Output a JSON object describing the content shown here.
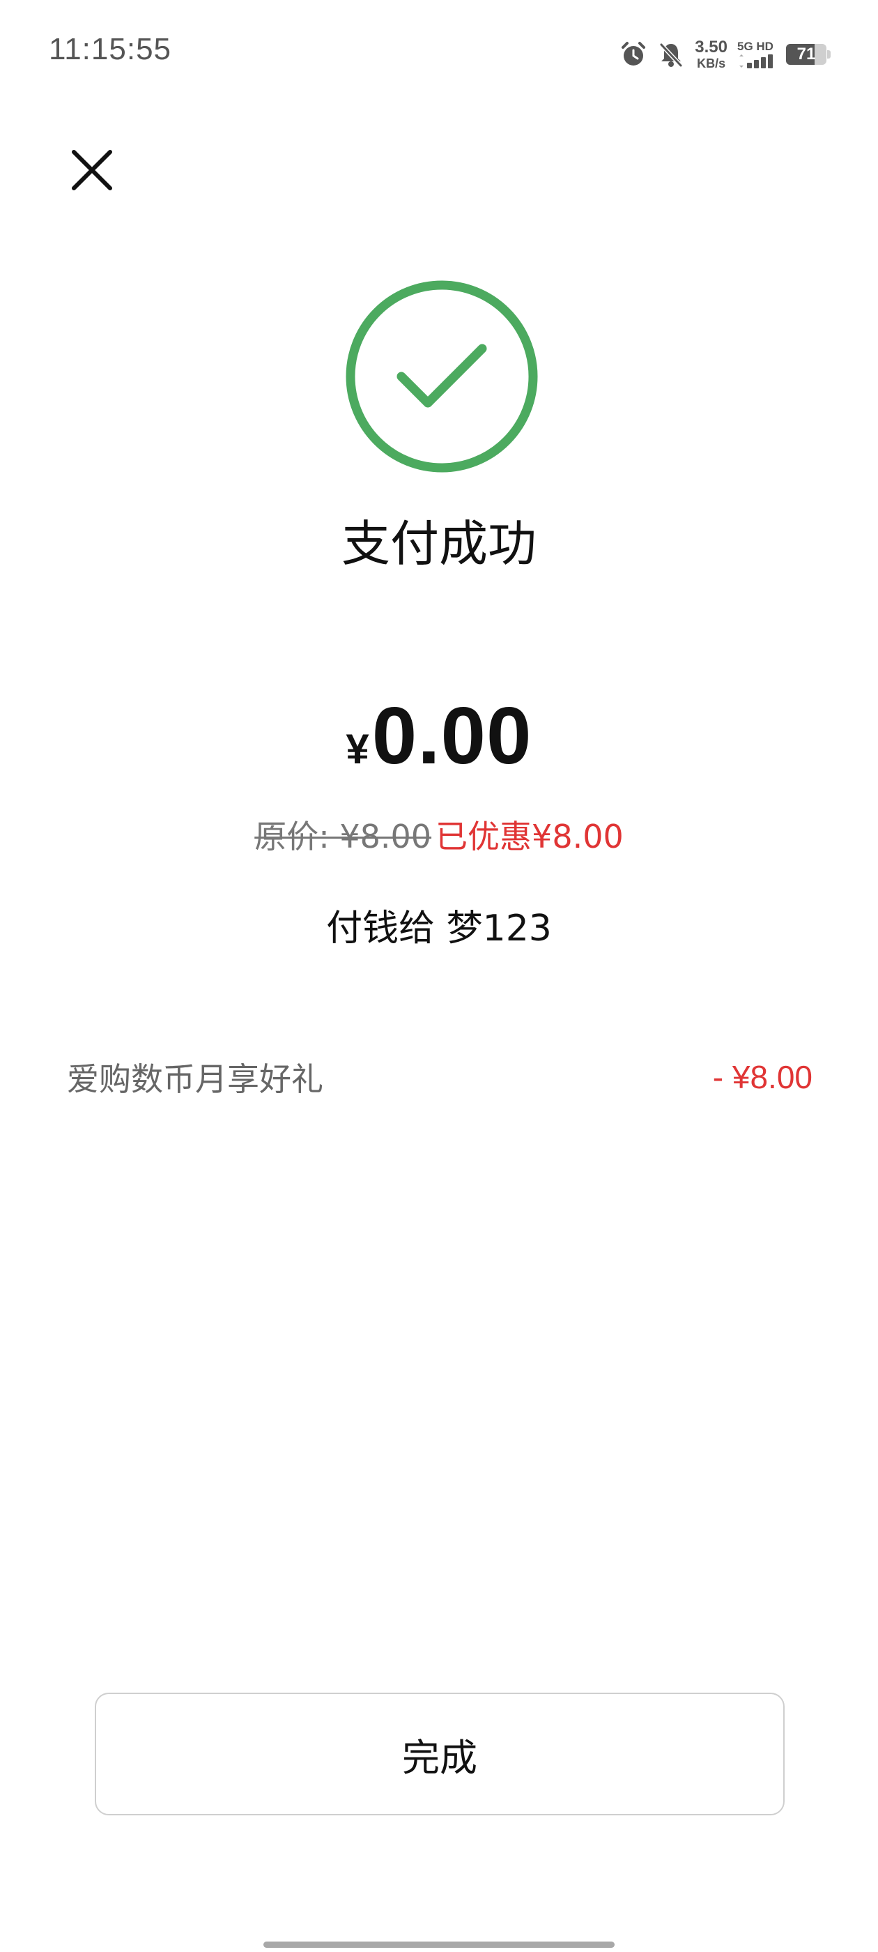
{
  "status_bar": {
    "time": "11:15:55",
    "net_speed_value": "3.50",
    "net_speed_unit": "KB/s",
    "network_label": "5G HD",
    "battery_level": "71",
    "battery_fraction": 0.71,
    "icons": [
      "alarm-icon",
      "bell-muted-icon",
      "signal-icon",
      "battery-icon"
    ]
  },
  "header": {
    "close_icon": "close-icon"
  },
  "result": {
    "icon": "check-circle-icon",
    "icon_color": "#4caa5f",
    "title": "支付成功",
    "currency_symbol": "¥",
    "amount": "0.00",
    "original_price": "原价: ¥8.00",
    "discount_text": "已优惠¥8.00",
    "discount_color": "#e03535",
    "payee": "付钱给 梦123"
  },
  "deduction": {
    "label": "爱购数币月享好礼",
    "amount": "- ¥8.00"
  },
  "footer": {
    "done_label": "完成"
  }
}
